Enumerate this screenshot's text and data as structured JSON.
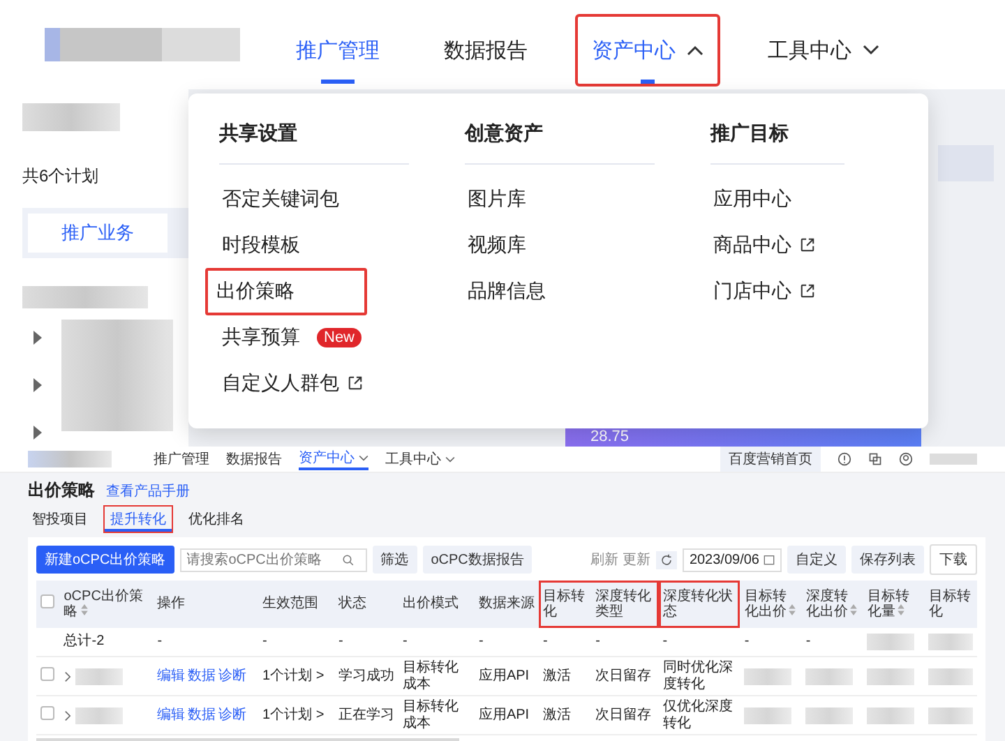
{
  "top_nav": {
    "items": [
      {
        "label": "推广管理",
        "selected": true,
        "has_menu": false,
        "highlighted": false
      },
      {
        "label": "数据报告",
        "selected": false,
        "has_menu": false,
        "highlighted": false
      },
      {
        "label": "资产中心",
        "selected": true,
        "has_menu": true,
        "expanded": true,
        "highlighted": true
      },
      {
        "label": "工具中心",
        "selected": false,
        "has_menu": true,
        "expanded": false,
        "highlighted": false
      }
    ]
  },
  "background": {
    "plan_count": "共6个计划",
    "tab": "推广业务",
    "banner_value": "28.75"
  },
  "dropdown": {
    "columns": [
      {
        "heading": "共享设置",
        "items": [
          {
            "label": "否定关键词包",
            "external": false,
            "highlighted": false
          },
          {
            "label": "时段模板",
            "external": false,
            "highlighted": false
          },
          {
            "label": "出价策略",
            "external": false,
            "highlighted": true
          },
          {
            "label": "共享预算",
            "external": false,
            "highlighted": false,
            "badge": "New"
          },
          {
            "label": "自定义人群包",
            "external": true,
            "highlighted": false
          }
        ]
      },
      {
        "heading": "创意资产",
        "items": [
          {
            "label": "图片库",
            "external": false,
            "highlighted": false
          },
          {
            "label": "视频库",
            "external": false,
            "highlighted": false
          },
          {
            "label": "品牌信息",
            "external": false,
            "highlighted": false
          }
        ]
      },
      {
        "heading": "推广目标",
        "items": [
          {
            "label": "应用中心",
            "external": false,
            "highlighted": false
          },
          {
            "label": "商品中心",
            "external": true,
            "highlighted": false
          },
          {
            "label": "门店中心",
            "external": true,
            "highlighted": false
          }
        ]
      }
    ]
  },
  "app": {
    "nav": [
      {
        "label": "推广管理",
        "selected": false,
        "has_menu": false
      },
      {
        "label": "数据报告",
        "selected": false,
        "has_menu": false
      },
      {
        "label": "资产中心",
        "selected": true,
        "has_menu": true
      },
      {
        "label": "工具中心",
        "selected": false,
        "has_menu": true
      }
    ],
    "home_button": "百度营销首页",
    "page_title": "出价策略",
    "manual_link": "查看产品手册",
    "tabs": [
      {
        "label": "智投项目",
        "selected": false,
        "highlighted": false
      },
      {
        "label": "提升转化",
        "selected": true,
        "highlighted": true
      },
      {
        "label": "优化排名",
        "selected": false,
        "highlighted": false
      }
    ],
    "toolbar": {
      "create_button": "新建oCPC出价策略",
      "search_placeholder": "请搜索oCPC出价策略",
      "filter_button": "筛选",
      "report_button": "oCPC数据报告",
      "refresh_label": "刷新 更新",
      "date": "2023/09/06",
      "custom_button": "自定义",
      "save_button": "保存列表",
      "download_button": "下载"
    },
    "table": {
      "select_all_checked": false,
      "columns": [
        {
          "label": "oCPC出价策略",
          "sortable": true,
          "framed": false
        },
        {
          "label": "操作",
          "sortable": false,
          "framed": false
        },
        {
          "label": "生效范围",
          "sortable": false,
          "framed": false
        },
        {
          "label": "状态",
          "sortable": false,
          "framed": false
        },
        {
          "label": "出价模式",
          "sortable": false,
          "framed": false
        },
        {
          "label": "数据来源",
          "sortable": false,
          "framed": false
        },
        {
          "label": "目标转化",
          "sortable": false,
          "framed": true,
          "frame_start": true
        },
        {
          "label": "深度转化类型",
          "sortable": false,
          "framed": true,
          "frame_start": false
        },
        {
          "label": "深度转化状态",
          "sortable": false,
          "framed": true,
          "frame_start": true
        },
        {
          "label": "目标转化出价",
          "sortable": true,
          "framed": false
        },
        {
          "label": "深度转化出价",
          "sortable": true,
          "framed": false
        },
        {
          "label": "目标转化量",
          "sortable": true,
          "framed": false
        },
        {
          "label": "目标转化",
          "sortable": false,
          "framed": false
        }
      ],
      "rows": [
        {
          "kind": "total",
          "cells": [
            "总计-2",
            "-",
            "-",
            "-",
            "-",
            "-",
            "-",
            "-",
            "-",
            "-",
            "-",
            null,
            null
          ]
        },
        {
          "kind": "item",
          "checked": false,
          "cells": [
            null,
            [
              "编辑",
              "数据",
              "诊断"
            ],
            "1个计划 >",
            "学习成功",
            "目标转化成本",
            "应用API",
            "激活",
            "次日留存",
            "同时优化深度转化",
            null,
            null,
            null,
            null
          ]
        },
        {
          "kind": "item",
          "checked": false,
          "cells": [
            null,
            [
              "编辑",
              "数据",
              "诊断"
            ],
            "1个计划 >",
            "正在学习",
            "目标转化成本",
            "应用API",
            "激活",
            "次日留存",
            "仅优化深度转化",
            null,
            null,
            null,
            null
          ]
        }
      ]
    }
  }
}
